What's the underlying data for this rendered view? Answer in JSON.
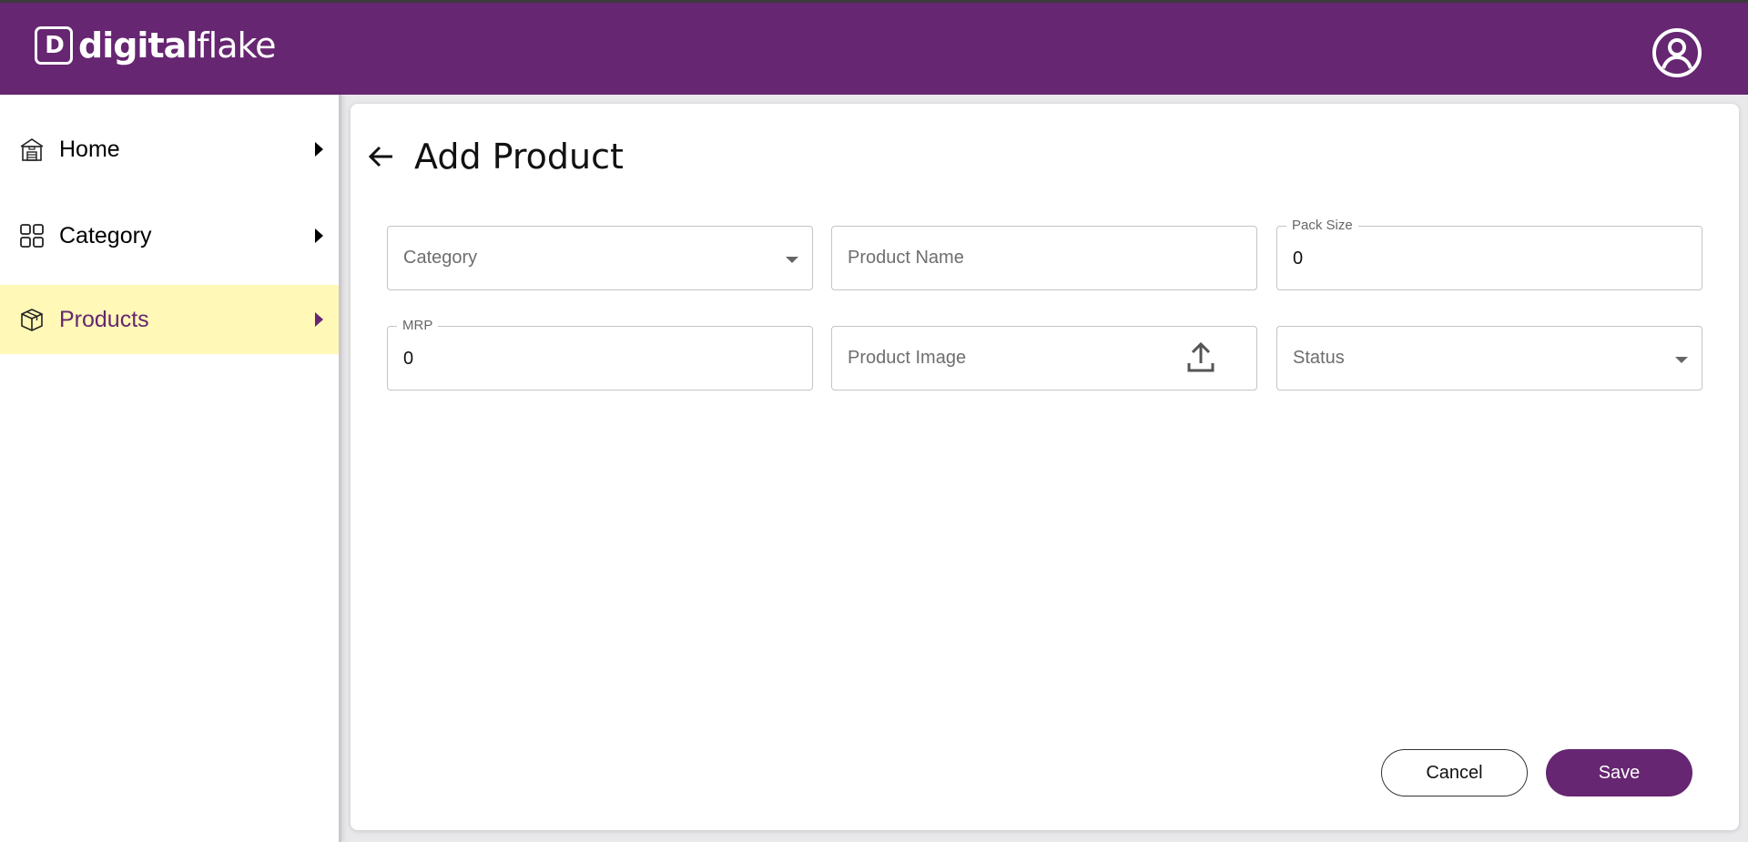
{
  "brand": {
    "mark": "D",
    "name_bold": "digital",
    "name_light": "flake"
  },
  "sidebar": {
    "items": [
      {
        "label": "Home",
        "icon": "home-building-icon",
        "active": false
      },
      {
        "label": "Category",
        "icon": "grid-icon",
        "active": false
      },
      {
        "label": "Products",
        "icon": "package-box-icon",
        "active": true
      }
    ]
  },
  "page": {
    "title": "Add Product"
  },
  "form": {
    "category": {
      "placeholder": "Category"
    },
    "product_name": {
      "placeholder": "Product Name"
    },
    "pack_size": {
      "label": "Pack Size",
      "value": "0"
    },
    "mrp": {
      "label": "MRP",
      "value": "0"
    },
    "product_image": {
      "placeholder": "Product Image"
    },
    "status": {
      "placeholder": "Status"
    }
  },
  "actions": {
    "cancel": "Cancel",
    "save": "Save"
  },
  "colors": {
    "brand": "#662671",
    "active_nav_bg": "#fff8b7"
  }
}
